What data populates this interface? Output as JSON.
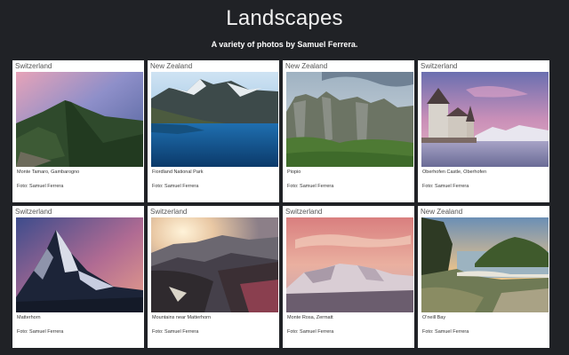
{
  "header": {
    "title": "Landscapes",
    "subtitle": "A variety of photos by Samuel Ferrera."
  },
  "cards": [
    {
      "country": "Switzerland",
      "caption": "Monte Tamaro, Gambarogno",
      "credit": "Foto: Samuel Ferrera"
    },
    {
      "country": "New Zealand",
      "caption": "Fiordland National Park",
      "credit": "Foto: Samuel Ferrera"
    },
    {
      "country": "New Zealand",
      "caption": "Piopio",
      "credit": "Foto: Samuel Ferrera"
    },
    {
      "country": "Switzerland",
      "caption": "Oberhofen Castle, Oberhofen",
      "credit": "Foto: Samuel Ferrera"
    },
    {
      "country": "Switzerland",
      "caption": "Matterhorn",
      "credit": "Foto: Samuel Ferrera"
    },
    {
      "country": "Switzerland",
      "caption": "Mountains near Matterhorn",
      "credit": "Foto: Samuel Ferrera"
    },
    {
      "country": "Switzerland",
      "caption": "Monte Rosa, Zermatt",
      "credit": "Foto: Samuel Ferrera"
    },
    {
      "country": "New Zealand",
      "caption": "O'neill Bay",
      "credit": "Foto: Samuel Ferrera"
    }
  ]
}
